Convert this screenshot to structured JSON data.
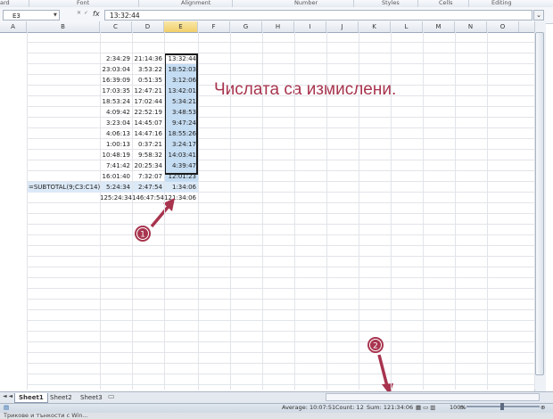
{
  "ribbon": {
    "groups": [
      "ard",
      "Font",
      "Alignment",
      "Number",
      "Styles",
      "Cells",
      "Editing"
    ]
  },
  "formula_bar": {
    "name_box": "E3",
    "fx_label": "fx",
    "cancel_symbol": "✕",
    "enter_symbol": "✓",
    "value": "13:32:44"
  },
  "columns": [
    "A",
    "B",
    "C",
    "D",
    "E",
    "F",
    "G",
    "H",
    "I",
    "J",
    "K",
    "L",
    "M",
    "N",
    "O"
  ],
  "sheet": {
    "c_values": [
      "2:34:29",
      "23:03:04",
      "16:39:09",
      "17:03:35",
      "18:53:24",
      "4:09:42",
      "3:23:04",
      "4:06:13",
      "1:00:13",
      "10:48:19",
      "7:41:42",
      "16:01:40"
    ],
    "d_values": [
      "21:14:36",
      "3:53:22",
      "0:51:35",
      "12:47:21",
      "17:02:44",
      "22:52:19",
      "14:45:07",
      "14:47:16",
      "0:37:21",
      "9:58:32",
      "20:25:34",
      "7:32:07"
    ],
    "e_values": [
      "13:32:44",
      "18:52:03",
      "3:12:06",
      "13:42:01",
      "5:34:21",
      "3:48:53",
      "9:47:24",
      "18:55:26",
      "3:24:17",
      "14:03:41",
      "4:39:47",
      "12:01:23"
    ],
    "subtotal_formula": "=SUBTOTAL(9;C3:C14)",
    "subtotal_c": "5:24:34",
    "subtotal_d": "2:47:54",
    "subtotal_e": "1:34:06",
    "total_c": "125:24:34",
    "total_d": "146:47:54",
    "total_e": "121:34:06"
  },
  "annotation": {
    "text": "Числата са измислени.",
    "marker_1": "1",
    "marker_2": "2",
    "color": "#a8344e"
  },
  "tabs": [
    "Sheet1",
    "Sheet2",
    "Sheet3"
  ],
  "status": {
    "average": "Average: 10:07:51",
    "count": "Count: 12",
    "sum": "Sum: 121:34:06",
    "zoom": "100%"
  },
  "taskbar": {
    "item": "Трикове и тънкости с Win..."
  }
}
